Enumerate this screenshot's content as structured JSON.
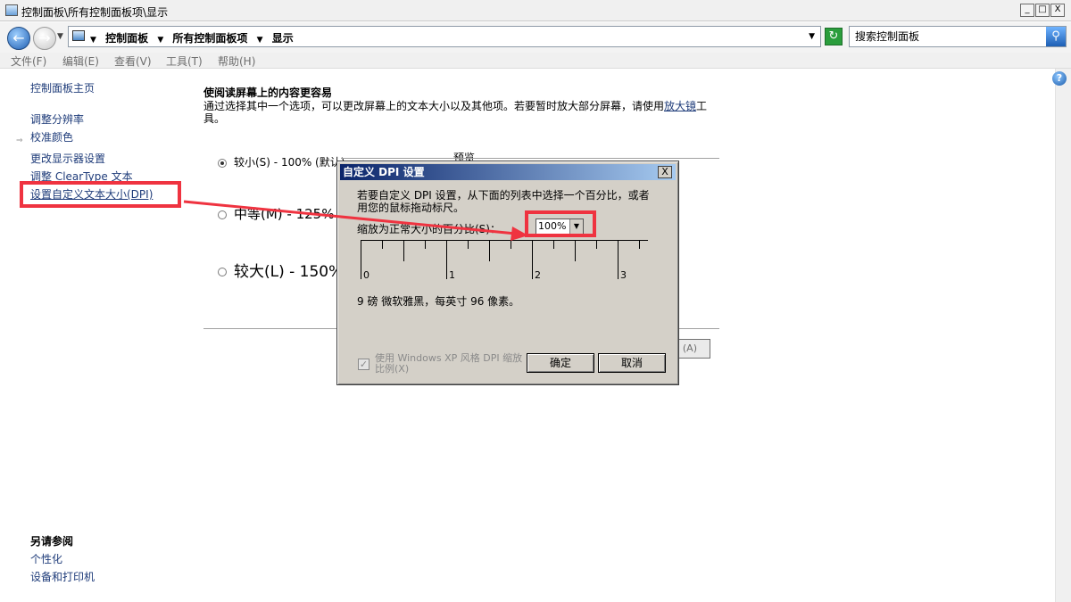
{
  "window": {
    "title": "控制面板\\所有控制面板项\\显示",
    "minimize": "_",
    "maximize": "□",
    "close": "X"
  },
  "address": {
    "crumbs": [
      "控制面板",
      "所有控制面板项",
      "显示"
    ],
    "search_placeholder": "搜索控制面板"
  },
  "menu": [
    "文件(F)",
    "编辑(E)",
    "查看(V)",
    "工具(T)",
    "帮助(H)"
  ],
  "sidebar": {
    "home": "控制面板主页",
    "items": [
      "调整分辨率",
      "校准颜色",
      "更改显示器设置",
      "调整 ClearType 文本",
      "设置自定义文本大小(DPI)"
    ],
    "see_also_title": "另请参阅",
    "see_also": [
      "个性化",
      "设备和打印机"
    ]
  },
  "main": {
    "heading": "使阅读屏幕上的内容更容易",
    "description": "通过选择其中一个选项，可以更改屏幕上的文本大小以及其他项。若要暂时放大部分屏幕，请使用",
    "magnifier_link": "放大镜",
    "description_tail": "工具。",
    "options": [
      {
        "label": "较小(S) - 100% (默认)",
        "selected": true
      },
      {
        "label": "中等(M) - 125%",
        "selected": false
      },
      {
        "label": "较大(L) - 150%",
        "selected": false
      }
    ],
    "preview_label": "预览",
    "apply_button": "(A)"
  },
  "dialog": {
    "title": "自定义 DPI 设置",
    "close": "X",
    "description": "若要自定义 DPI 设置，从下面的列表中选择一个百分比，或者用您的鼠标拖动标尺。",
    "scale_label": "缩放为正常大小的百分比(S)：",
    "scale_value": "100%",
    "ruler_labels": [
      "0",
      "1",
      "2",
      "3"
    ],
    "font_info": "9 磅 微软雅黑，每英寸 96 像素。",
    "xp_style_label": "使用 Windows XP 风格 DPI 缩放比例(X)",
    "xp_style_checked": true,
    "ok_button": "确定",
    "cancel_button": "取消"
  },
  "colors": {
    "highlight": "#ef3340",
    "link": "#1f3c7a",
    "dialog_bg": "#d4d0c8"
  }
}
